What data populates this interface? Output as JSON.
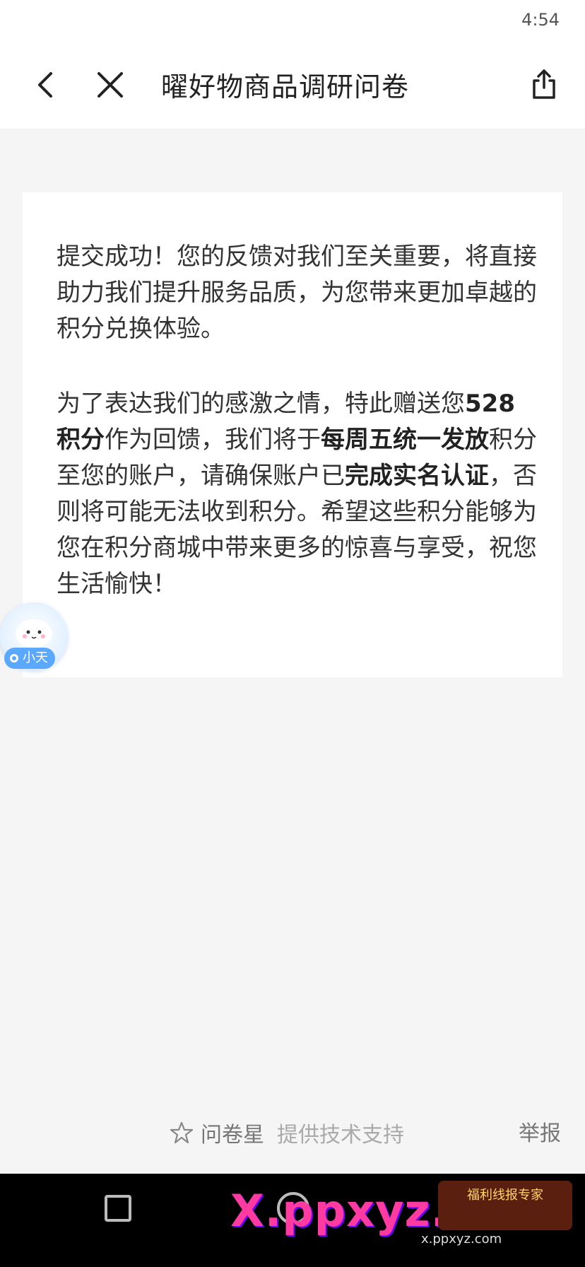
{
  "status_bar": {
    "time": "4:54"
  },
  "nav": {
    "title": "曜好物商品调研问卷",
    "back_icon": "chevron-left-icon",
    "close_icon": "close-icon",
    "share_icon": "share-icon"
  },
  "message": {
    "para1": "提交成功！您的反馈对我们至关重要，将直接助力我们提升服务品质，为您带来更加卓越的积分兑换体验。",
    "para2_part1": "为了表达我们的感激之情，特此赠送您",
    "para2_bold1": "528积分",
    "para2_part2": "作为回馈，我们将于",
    "para2_bold2": "每周五统一发放",
    "para2_part3": "积分至您的账户，请确保账户已",
    "para2_bold3": "完成实名认证",
    "para2_part4": "，否则将可能无法收到积分。希望这些积分能够为您在积分商城中带来更多的惊喜与享受，祝您生活愉快！"
  },
  "assistant": {
    "label": "小天"
  },
  "footer": {
    "brand": "问卷星",
    "support": "提供技术支持",
    "report": "举报"
  },
  "watermark": {
    "text": "X.ppxyz.com",
    "sub": "x.ppxyz.com",
    "badge": "福利线报专家"
  }
}
